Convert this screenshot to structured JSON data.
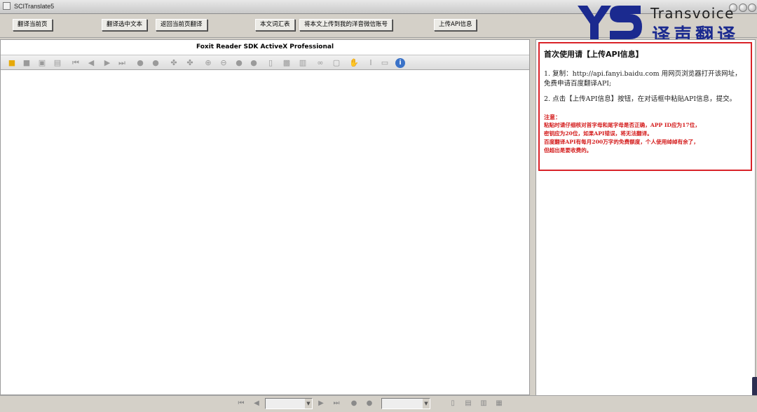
{
  "window": {
    "title": "SCITranslate5"
  },
  "toolbar": {
    "btn_translate_page": "翻译当前页",
    "btn_translate_selection": "翻译选中文本",
    "btn_return_page": "返回当前页翻译",
    "btn_glossary": "本文词汇表",
    "btn_upload_wechat": "将本文上传到我的洋音微信账号",
    "btn_upload_api": "上传API信息"
  },
  "logo": {
    "brand": "Transvoice",
    "cn": "译声翻译",
    "color": "#1b2a8f"
  },
  "viewer": {
    "title": "Foxit Reader SDK ActiveX Professional",
    "tools": [
      "open-folder-icon",
      "save-icon",
      "floppy-icon",
      "print-icon",
      "first-page-icon",
      "prev-page-icon",
      "next-page-icon",
      "last-page-icon",
      "back-icon",
      "forward-icon",
      "rotate-left-icon",
      "rotate-right-icon",
      "zoom-in-icon",
      "zoom-out-icon",
      "prev-view-icon",
      "next-view-icon",
      "fit-page-icon",
      "fit-width-icon",
      "fit-visible-icon",
      "binoculars-icon",
      "page-icon",
      "hand-tool-icon",
      "select-text-icon",
      "snapshot-icon",
      "info-icon"
    ]
  },
  "sidebar": {
    "title": "首次使用请【上传API信息】",
    "step1": "1. 复制：http://api.fanyi.baidu.com 用网页浏览器打开该网址，免费申请百度翻译API;",
    "step2": "2. 点击【上传API信息】按钮，在对话框中粘贴API信息，提交。",
    "note_heading": "注意：",
    "note_lines": [
      "粘贴时请仔细核对首字母和尾字母是否正确，APP ID应为17位，",
      "密钥应为20位，如果API错误，将无法翻译。",
      "百度翻译API有每月200万字的免费额度，个人使用绰绰有余了，",
      "但超出是要收费的。"
    ],
    "accent": "#d92228"
  }
}
